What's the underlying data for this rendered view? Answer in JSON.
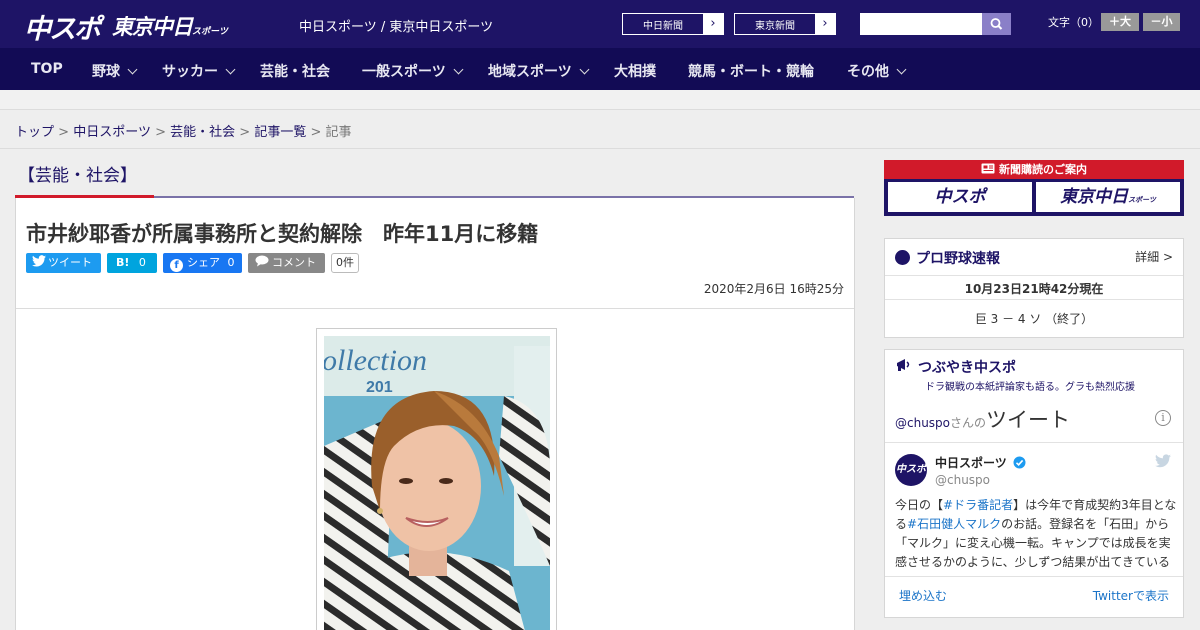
{
  "header": {
    "logo_chuspo": "中スポ",
    "logo_tokyo": "東京中日",
    "logo_tokyo_sub": "スポーツ",
    "site_title": "中日スポーツ / 東京中日スポーツ",
    "ext_links": [
      "中日新聞",
      "東京新聞"
    ],
    "search_placeholder": "",
    "font_size_label": "文字（0）",
    "font_larger": "＋大",
    "font_smaller": "－小"
  },
  "nav": [
    {
      "label": "TOP",
      "dropdown": false
    },
    {
      "label": "野球",
      "dropdown": true
    },
    {
      "label": "サッカー",
      "dropdown": true
    },
    {
      "label": "芸能・社会",
      "dropdown": false
    },
    {
      "label": "一般スポーツ",
      "dropdown": true
    },
    {
      "label": "地域スポーツ",
      "dropdown": true
    },
    {
      "label": "大相撲",
      "dropdown": false
    },
    {
      "label": "競馬・ボート・競輪",
      "dropdown": false
    },
    {
      "label": "その他",
      "dropdown": true
    }
  ],
  "breadcrumb": {
    "items": [
      "トップ",
      "中日スポーツ",
      "芸能・社会",
      "記事一覧"
    ],
    "current": "記事",
    "separator": ">"
  },
  "article": {
    "category": "【芸能・社会】",
    "headline": "市井紗耶香が所属事務所と契約解除　昨年11月に移籍",
    "share": {
      "tweet": "ツイート",
      "hatena": "B!",
      "hatena_count": "0",
      "facebook": "シェア",
      "facebook_count": "0",
      "comment": "コメント",
      "comment_count": "0件"
    },
    "date": "2020年2月6日 16時25分",
    "photo_text": "ollection",
    "photo_year": "201"
  },
  "sidebar": {
    "promo_banner": "新聞購読のご案内",
    "promo_logos": [
      "中スポ",
      "東京中日"
    ],
    "promo_logo_sub": "スポーツ",
    "baseball": {
      "title": "プロ野球速報",
      "more": "詳細 >",
      "updated": "10月23日21時42分現在",
      "score": "巨 3 － 4 ソ （終了）"
    },
    "tsubuyaki": {
      "title": "つぶやき中スポ",
      "subtitle": "ドラ観戦の本紙評論家も語る。グラも熱烈応援"
    },
    "twitter": {
      "handle_link": "@chuspo",
      "handle_suffix": "さんの",
      "tweets_label": "ツイート",
      "account_name": "中日スポーツ",
      "account_handle": "@chuspo",
      "avatar_text": "中スポ",
      "body_1": "今日の【",
      "tag_1": "#ドラ番記者",
      "body_2": "】は今年で育成契約3年目となる",
      "tag_2": "#石田健人マルク",
      "body_3": "のお話。登録名を「石田」から「マルク」に変え心機一転。キャンプでは成長を実感させるかのように、少しずつ結果が出てきている",
      "embed": "埋め込む",
      "view_on": "Twitterで表示"
    }
  },
  "colors": {
    "brand_navy": "#1e1466",
    "nav_bg": "#120b55",
    "accent_red": "#d11a2a",
    "twitter_blue": "#1d9bf0",
    "hatena_blue": "#00a4de",
    "facebook_blue": "#1877f2",
    "comment_gray": "#888888"
  }
}
